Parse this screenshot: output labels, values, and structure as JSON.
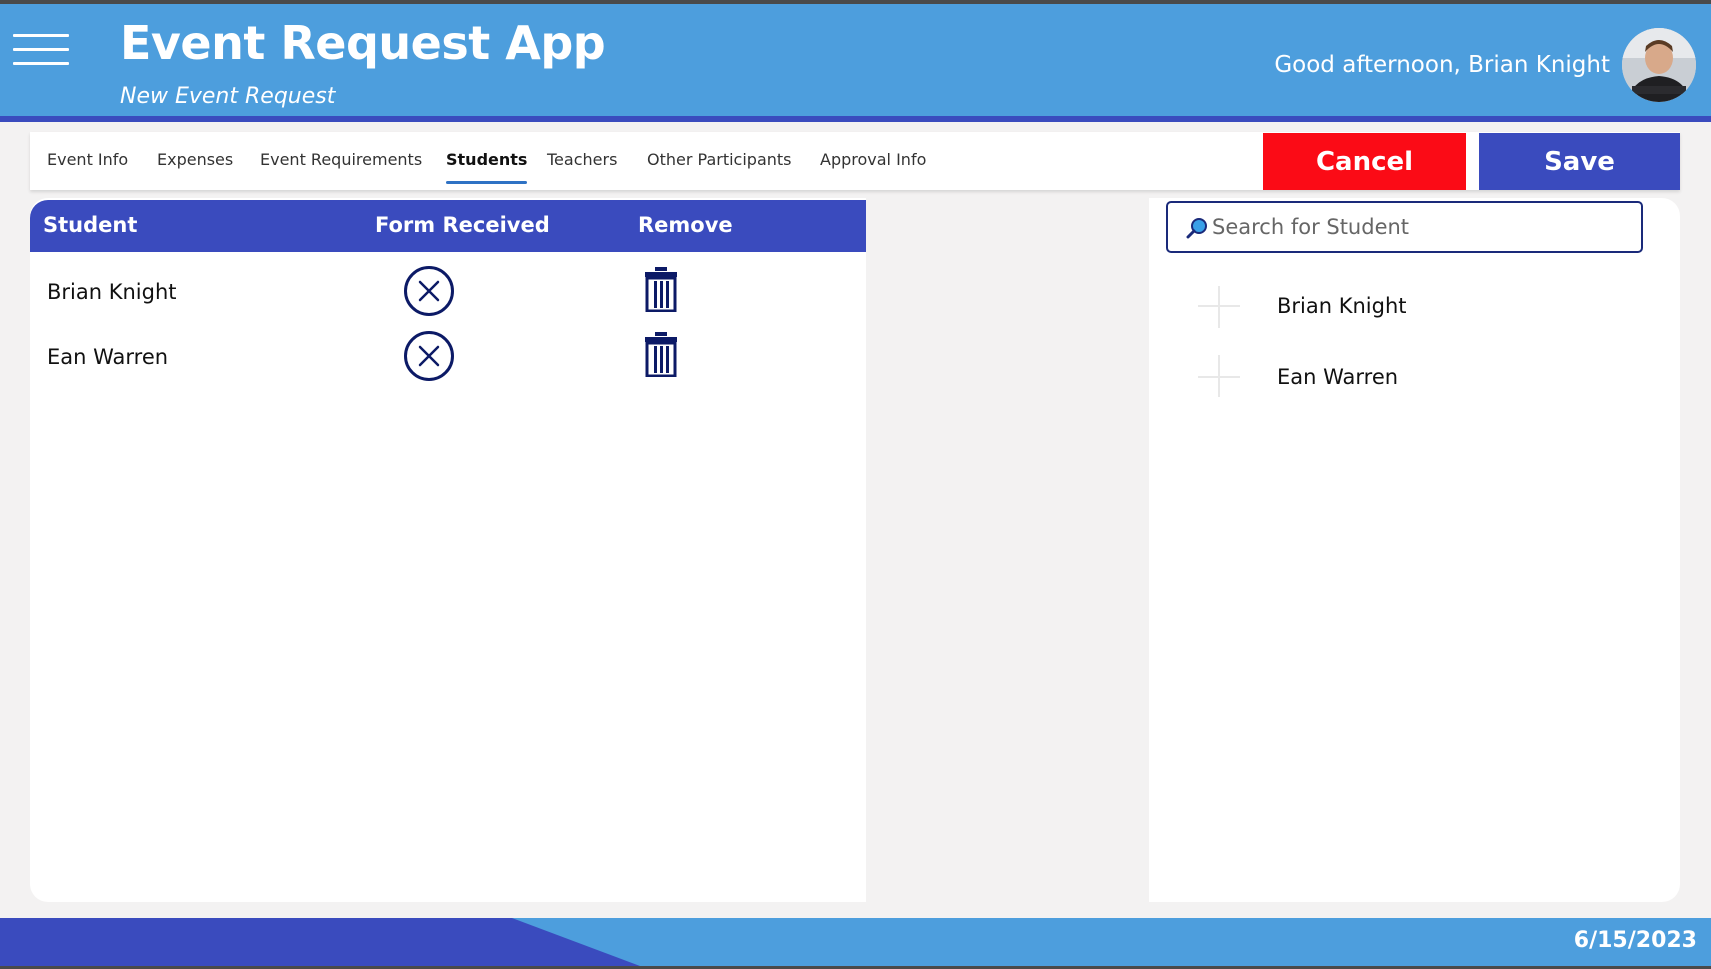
{
  "header": {
    "title": "Event Request App",
    "subtitle": "New Event Request",
    "greeting": "Good afternoon,  Brian Knight",
    "menu_icon": "hamburger-menu-icon",
    "avatar_icon": "user-avatar-photo"
  },
  "tabs": [
    {
      "label": "Event Info",
      "active": false
    },
    {
      "label": "Expenses",
      "active": false
    },
    {
      "label": "Event Requirements",
      "active": false
    },
    {
      "label": "Students",
      "active": true
    },
    {
      "label": "Teachers",
      "active": false
    },
    {
      "label": "Other Participants",
      "active": false
    },
    {
      "label": "Approval Info",
      "active": false
    }
  ],
  "actions": {
    "cancel_label": "Cancel",
    "save_label": "Save"
  },
  "students_grid": {
    "columns": [
      "Student",
      "Form Received",
      "Remove"
    ],
    "rows": [
      {
        "name": "Brian Knight",
        "form_received_icon": "x-circle-icon",
        "remove_icon": "trash-icon"
      },
      {
        "name": "Ean Warren",
        "form_received_icon": "x-circle-icon",
        "remove_icon": "trash-icon"
      }
    ]
  },
  "search": {
    "placeholder": "Search for Student",
    "value": "",
    "icon": "search-icon",
    "results": [
      {
        "label": "Brian Knight",
        "icon": "plus-icon"
      },
      {
        "label": "Ean Warren",
        "icon": "plus-icon"
      }
    ]
  },
  "footer": {
    "date": "6/15/2023"
  },
  "colors": {
    "header_blue": "#4d9edd",
    "accent_navy": "#3a4bbe",
    "cancel_red": "#fb0b16",
    "icon_navy": "#0c1a66",
    "background": "#f3f2f2"
  }
}
